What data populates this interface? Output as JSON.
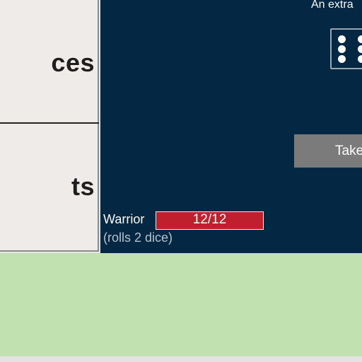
{
  "left_panel": {
    "sections": [
      {
        "label": "ces"
      },
      {
        "label": "ts"
      }
    ]
  },
  "game": {
    "top_text": "An extra",
    "die": {
      "icon": "die-six-icon",
      "value": 6
    },
    "take_button_label": "Take",
    "unit": {
      "name": "Warrior",
      "hp_text": "12/12",
      "hp_fraction": 1.0,
      "subtitle": "(rolls 2 dice)"
    }
  },
  "colors": {
    "game_bg": "#042744",
    "left_bg": "#efebe9",
    "bottom_bg": "#c1e1b0",
    "hp_bar": "#c0202e",
    "button_bg": "#7b7b7b"
  }
}
